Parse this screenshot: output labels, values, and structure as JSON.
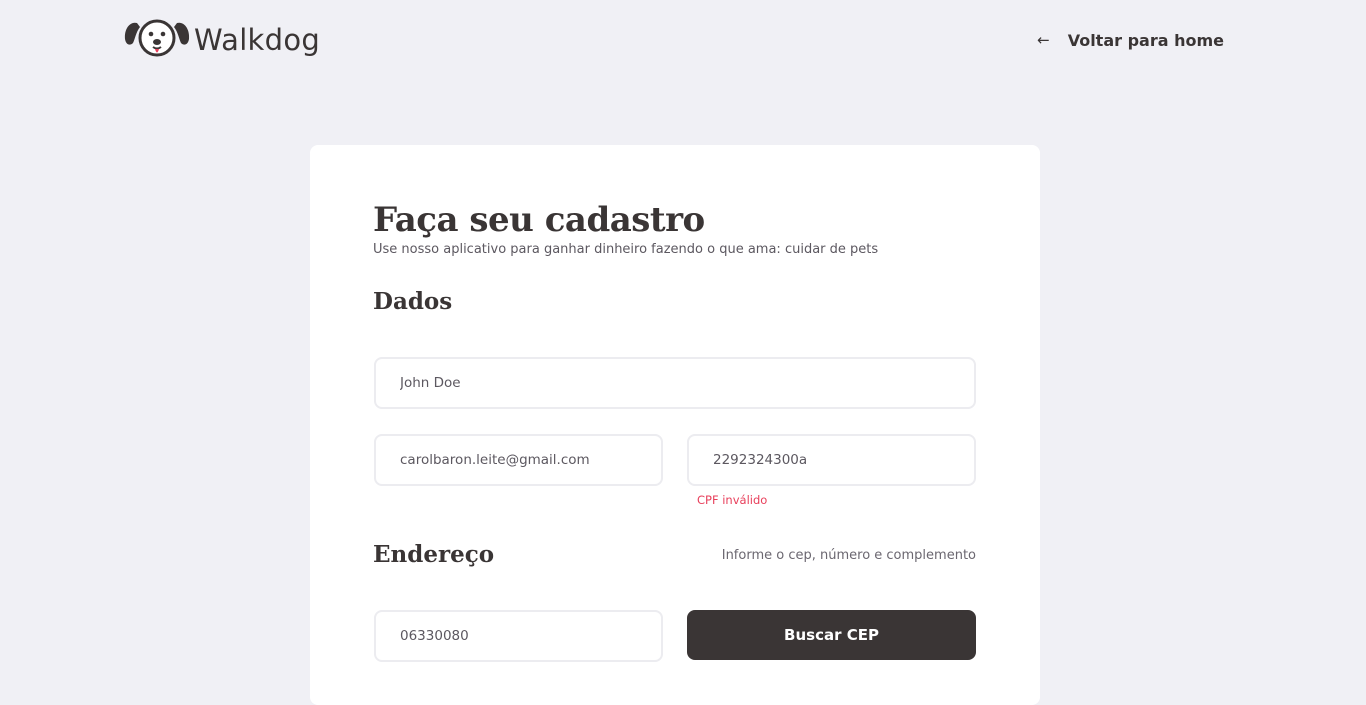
{
  "header": {
    "logo_text": "Walkdog",
    "back_label": "Voltar para home",
    "back_icon": "arrow-left-icon",
    "logo_icon": "dog-face-icon"
  },
  "form": {
    "title": "Faça seu cadastro",
    "subtitle": "Use nosso aplicativo para ganhar dinheiro fazendo o que ama: cuidar de pets",
    "dados": {
      "title": "Dados",
      "name_value": "John Doe",
      "email_value": "carolbaron.leite@gmail.com",
      "cpf_value": "2292324300a",
      "cpf_error": "CPF inválido"
    },
    "endereco": {
      "title": "Endereço",
      "hint": "Informe o cep, número e complemento",
      "cep_value": "06330080",
      "search_button": "Buscar CEP"
    }
  },
  "colors": {
    "background": "#f0f0f5",
    "card": "#ffffff",
    "primary": "#3a3535",
    "error": "#e83f5b"
  }
}
